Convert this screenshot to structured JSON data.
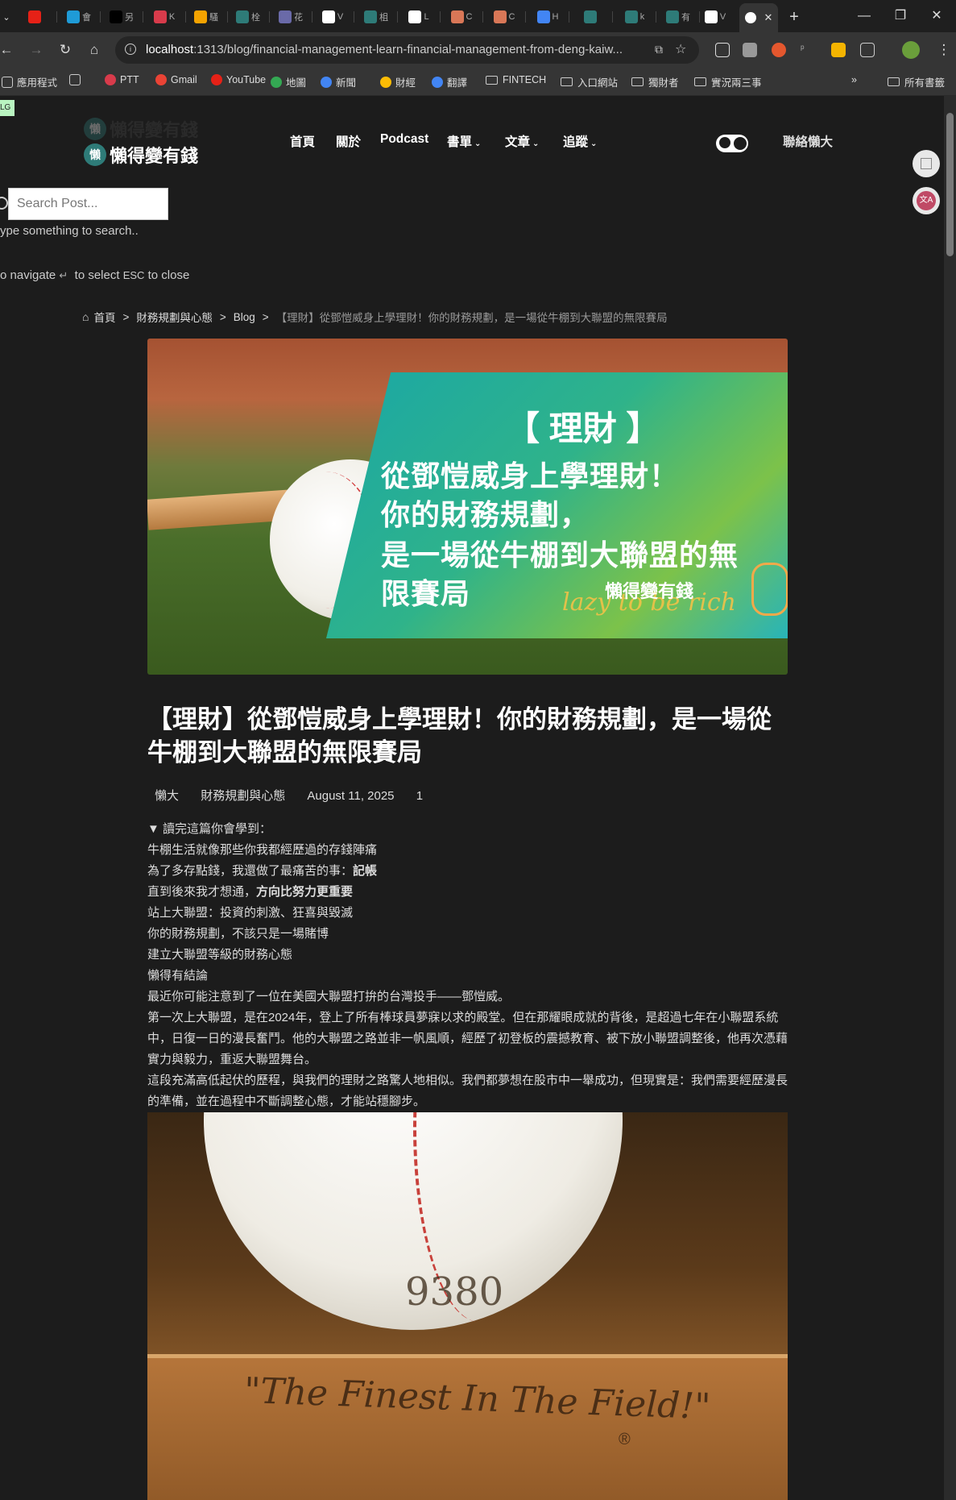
{
  "tabs": {
    "active_icon": "github-icon",
    "new_tab": "+",
    "items": [
      {
        "icon": "youtube-favicon",
        "color": "#e62117",
        "text": ""
      },
      {
        "icon": "site-favicon",
        "color": "#1f9bd7",
        "text": "會"
      },
      {
        "icon": "medium-favicon",
        "color": "#000000",
        "text": "另"
      },
      {
        "icon": "site-favicon",
        "color": "#d83b4b",
        "text": "K"
      },
      {
        "icon": "analytics-favicon",
        "color": "#f4a300",
        "text": "騷"
      },
      {
        "icon": "lazy-favicon",
        "color": "#2e7b78",
        "text": "栓"
      },
      {
        "icon": "store-favicon",
        "color": "#6a6aa8",
        "text": "花"
      },
      {
        "icon": "github-favicon",
        "color": "#ffffff",
        "text": "V"
      },
      {
        "icon": "lazy-favicon",
        "color": "#2e7b78",
        "text": "柤"
      },
      {
        "icon": "notion-favicon",
        "color": "#ffffff",
        "text": "L"
      },
      {
        "icon": "claude-favicon",
        "color": "#d97757",
        "text": "C"
      },
      {
        "icon": "claude-favicon",
        "color": "#d97757",
        "text": "C"
      },
      {
        "icon": "google-favicon",
        "color": "#4285f4",
        "text": "H"
      },
      {
        "icon": "lazy-favicon",
        "color": "#2e7b78",
        "text": ""
      },
      {
        "icon": "lazy-favicon",
        "color": "#2e7b78",
        "text": "k"
      },
      {
        "icon": "lazy-favicon",
        "color": "#2e7b78",
        "text": "有"
      },
      {
        "icon": "github-favicon",
        "color": "#ffffff",
        "text": "V"
      }
    ]
  },
  "window": {
    "minimize": "—",
    "restore": "❐",
    "close": "✕"
  },
  "omnibox": {
    "host": "localhost",
    "path": ":1313/blog/financial-management-learn-financial-management-from-deng-kaiw..."
  },
  "bookmarks": {
    "items": [
      {
        "label": "應用程式",
        "type": "apps"
      },
      {
        "label": "",
        "type": "grid"
      },
      {
        "label": "PTT",
        "type": "site",
        "color": "#d83b4b"
      },
      {
        "label": "Gmail",
        "type": "site",
        "color": "#ea4335"
      },
      {
        "label": "YouTube",
        "type": "site",
        "color": "#e62117"
      },
      {
        "label": "地圖",
        "type": "site",
        "color": "#34a853"
      },
      {
        "label": "新聞",
        "type": "site",
        "color": "#4285f4"
      },
      {
        "label": "財經",
        "type": "site",
        "color": "#fbbc05"
      },
      {
        "label": "翻譯",
        "type": "site",
        "color": "#4285f4"
      },
      {
        "label": "FINTECH",
        "type": "folder"
      },
      {
        "label": "入口網站",
        "type": "folder"
      },
      {
        "label": "獨財者",
        "type": "folder"
      },
      {
        "label": "實況兩三事",
        "type": "folder"
      }
    ],
    "overflow": "»",
    "all_bookmarks": "所有書籤"
  },
  "site": {
    "logo_text": "懶得變有錢",
    "logo_char": "懶",
    "corner_tag": "LG",
    "nav": [
      {
        "label": "首頁",
        "dropdown": false
      },
      {
        "label": "關於",
        "dropdown": false
      },
      {
        "label": "Podcast",
        "dropdown": false
      },
      {
        "label": "書單",
        "dropdown": true
      },
      {
        "label": "文章",
        "dropdown": true
      },
      {
        "label": "追蹤",
        "dropdown": true
      }
    ],
    "contact": "聯絡懶大"
  },
  "search": {
    "placeholder": "Search Post...",
    "hint": "ype something to search..",
    "keys_navigate": "o navigate",
    "keys_select": "to select",
    "keys_esc": "ESC",
    "keys_close": "to close"
  },
  "breadcrumb": {
    "home": "首頁",
    "category": "財務規劃與心態",
    "section": "Blog",
    "current": "【理財】從鄧愷威身上學理財！你的財務規劃，是一場從牛棚到大聯盟的無限賽局",
    "sep": ">"
  },
  "hero": {
    "title": "【 理財 】",
    "lines": [
      "從鄧愷威身上學理財！",
      "你的財務規劃，",
      "是一場從牛棚到大聯盟的無",
      "限賽局"
    ],
    "brand": "懶得變有錢",
    "script": "lazy to be rich"
  },
  "post": {
    "title": "【理財】從鄧愷威身上學理財！你的財務規劃，是一場從牛棚到大聯盟的無限賽局",
    "author": "懶大",
    "category": "財務規劃與心態",
    "date": "August 11, 2025",
    "count": "1"
  },
  "toc": {
    "summary": "▼ 讀完這篇你會學到：",
    "items": [
      {
        "pre": "牛棚生活就像那些你我都經歷過的存錢陣痛",
        "bold": ""
      },
      {
        "pre": "為了多存點錢，我還做了最痛苦的事：",
        "bold": "記帳"
      },
      {
        "pre": "直到後來我才想通，",
        "bold": "方向比努力更重要"
      },
      {
        "pre": "站上大聯盟：投資的刺激、狂喜與毀滅",
        "bold": ""
      },
      {
        "pre": "你的財務規劃，不該只是一場賭博",
        "bold": ""
      },
      {
        "pre": "建立大聯盟等級的財務心態",
        "bold": ""
      },
      {
        "pre": "懶得有結論",
        "bold": ""
      }
    ]
  },
  "body": {
    "p1": "最近你可能注意到了一位在美國大聯盟打拚的台灣投手——鄧愷威。",
    "p2": "第一次上大聯盟，是在2024年，登上了所有棒球員夢寐以求的殿堂。但在那耀眼成就的背後，是超過七年在小聯盟系統中，日復一日的漫長奮鬥。他的大聯盟之路並非一帆風順，經歷了初登板的震撼教育、被下放小聯盟調整後，他再次憑藉實力與毅力，重返大聯盟舞台。",
    "p3": "這段充滿高低起伏的歷程，與我們的理財之路驚人地相似。我們都夢想在股市中一舉成功，但現實是：我們需要經歷漫長的準備，並在過程中不斷調整心態，才能站穩腳步。"
  },
  "image2": {
    "number": "9380",
    "slogan": "\"The Finest In The Field!\"",
    "registered": "®"
  }
}
